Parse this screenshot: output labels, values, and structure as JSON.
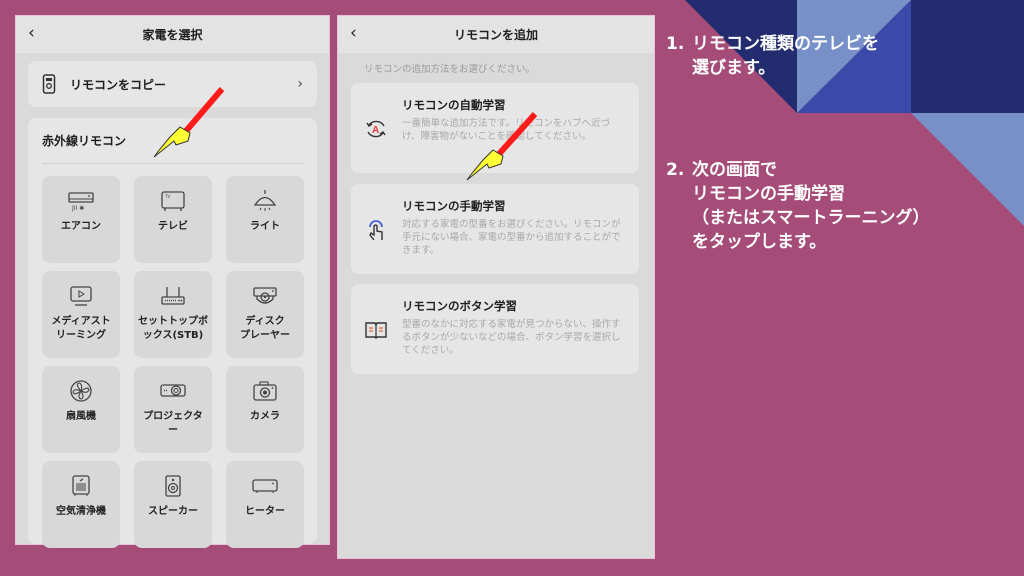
{
  "colors": {
    "background": "#a54d78",
    "navy": "#232c6e",
    "mid_blue": "#3b4aa8",
    "light_blue": "#7890c8",
    "panel_bg": "#dadada",
    "card_bg": "#e6e6e6",
    "tile_bg": "#d8d8d8",
    "pointer_red": "#ff1a1a",
    "pointer_yellow": "#ffff33",
    "manual_icon_blue": "#3a4fd0",
    "auto_icon_red": "#e53935",
    "book_icon_orange": "#e0703a"
  },
  "screen1": {
    "title": "家電を選択",
    "back_icon": "chevron-left-icon",
    "copy_remote": {
      "label": "リモコンをコピー",
      "icon": "remote-icon",
      "chevron": "›"
    },
    "ir_section": {
      "heading": "赤外線リモコン",
      "devices": [
        {
          "label": "エアコン",
          "icon": "air-conditioner-icon"
        },
        {
          "label": "テレビ",
          "icon": "tv-icon"
        },
        {
          "label": "ライト",
          "icon": "light-icon"
        },
        {
          "label": "メディアスト\nリーミング",
          "icon": "media-streaming-icon"
        },
        {
          "label": "セットトップボ\nックス(STB)",
          "icon": "set-top-box-icon"
        },
        {
          "label": "ディスク\nプレーヤー",
          "icon": "disc-player-icon"
        },
        {
          "label": "扇風機",
          "icon": "fan-icon"
        },
        {
          "label": "プロジェクタ\nー",
          "icon": "projector-icon"
        },
        {
          "label": "カメラ",
          "icon": "camera-icon"
        },
        {
          "label": "空気清浄機",
          "icon": "air-purifier-icon"
        },
        {
          "label": "スピーカー",
          "icon": "speaker-icon"
        },
        {
          "label": "ヒーター",
          "icon": "heater-icon"
        }
      ]
    }
  },
  "screen2": {
    "title": "リモコンを追加",
    "back_icon": "chevron-left-icon",
    "hint": "リモコンの追加方法をお選びください。",
    "methods": [
      {
        "title": "リモコンの自動学習",
        "desc": "一番簡単な追加方法です。リモコンをハブへ近づけ、障害物がないことを確認してください。",
        "icon": "auto-learn-icon"
      },
      {
        "title": "リモコンの手動学習",
        "desc": "対応する家電の型番をお選びください。リモコンが手元にない場合、家電の型番から追加することができます。",
        "icon": "tap-hand-icon"
      },
      {
        "title": "リモコンのボタン学習",
        "desc": "型番のなかに対応する家電が見つからない、操作するボタンが少ないなどの場合、ボタン学習を選択してください。",
        "icon": "book-icon"
      }
    ]
  },
  "instructions": {
    "step1": {
      "num": "1.",
      "lines": [
        "リモコン種類のテレビを",
        "選びます。"
      ]
    },
    "step2": {
      "num": "2.",
      "lines": [
        "次の画面で",
        "リモコンの手動学習",
        "（またはスマートラーニング）",
        "をタップします。"
      ]
    }
  }
}
